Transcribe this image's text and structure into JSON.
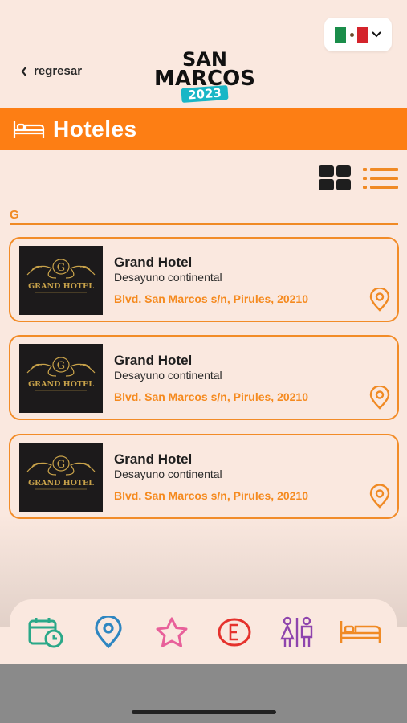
{
  "language": {
    "flag": "mexico-flag",
    "chevron": "chevron-down-icon"
  },
  "nav": {
    "back_label": "regresar"
  },
  "logo": {
    "line1": "SAN",
    "line2": "MARCOS",
    "year": "2023"
  },
  "header": {
    "title": "Hoteles",
    "icon": "bed-icon",
    "color": "#fd7e14"
  },
  "view": {
    "grid_icon": "grid-icon",
    "list_icon": "list-icon"
  },
  "search": {
    "value": "G"
  },
  "hotels": [
    {
      "name": "Grand Hotel",
      "description": "Desayuno continental",
      "address": "Blvd. San Marcos s/n, Pirules, 20210",
      "logo_text": "GRAND HOTEL",
      "logo_initial": "G"
    },
    {
      "name": "Grand Hotel",
      "description": "Desayuno continental",
      "address": "Blvd. San Marcos s/n, Pirules, 20210",
      "logo_text": "GRAND HOTEL",
      "logo_initial": "G"
    },
    {
      "name": "Grand Hotel",
      "description": "Desayuno continental",
      "address": "Blvd. San Marcos s/n, Pirules, 20210",
      "logo_text": "GRAND HOTEL",
      "logo_initial": "G"
    }
  ],
  "tabs": [
    {
      "id": "calendar",
      "icon": "calendar-clock-icon",
      "color": "#2aa888"
    },
    {
      "id": "map",
      "icon": "map-pin-icon",
      "color": "#2e86c1"
    },
    {
      "id": "favorites",
      "icon": "star-icon",
      "color": "#e8609a"
    },
    {
      "id": "events",
      "icon": "e-circle-icon",
      "color": "#e5322d"
    },
    {
      "id": "restrooms",
      "icon": "restroom-icon",
      "color": "#8e44ad"
    },
    {
      "id": "hotels",
      "icon": "bed-icon",
      "color": "#f08a24"
    }
  ],
  "colors": {
    "accent": "#fd7e14",
    "background": "#fae8df",
    "address": "#f58a1f"
  }
}
